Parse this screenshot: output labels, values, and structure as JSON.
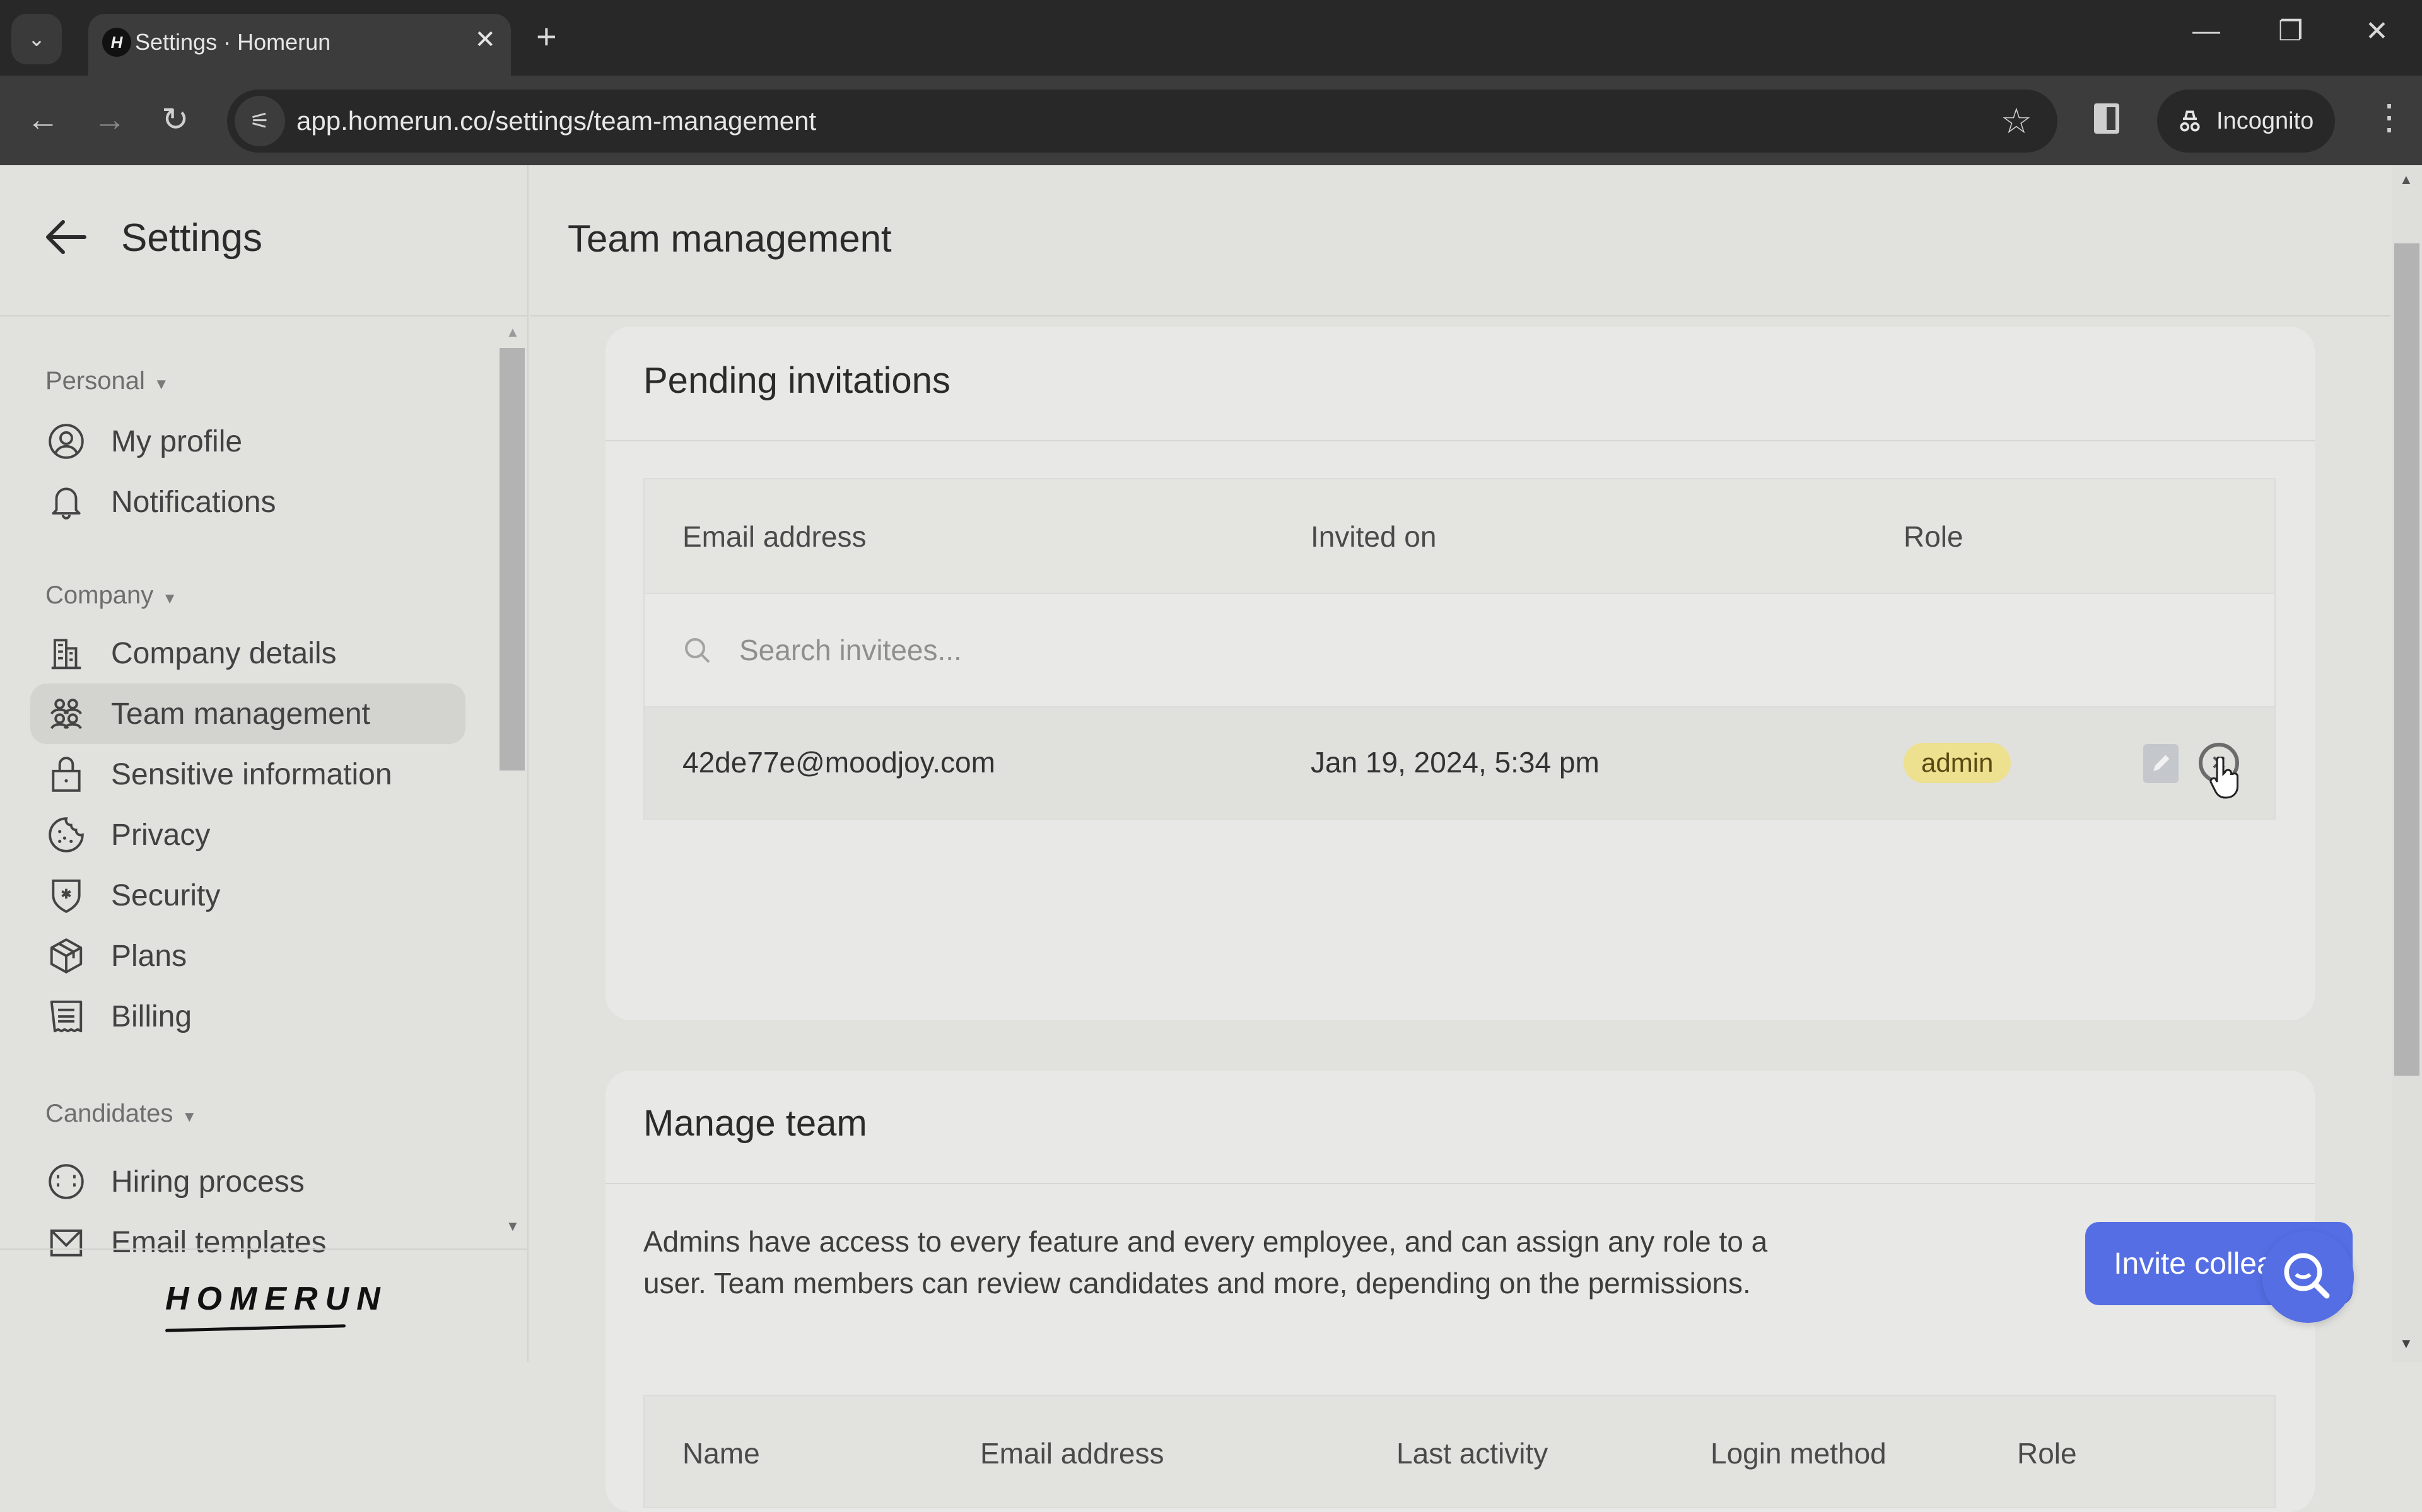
{
  "browser": {
    "tab_title": "Settings · Homerun",
    "favicon_letter": "H",
    "url": "app.homerun.co/settings/team-management",
    "incognito_label": "Incognito"
  },
  "sidebar": {
    "title": "Settings",
    "sections": [
      {
        "label": "Personal",
        "items": [
          {
            "label": "My profile",
            "icon": "user-circle-icon"
          },
          {
            "label": "Notifications",
            "icon": "bell-icon"
          }
        ]
      },
      {
        "label": "Company",
        "items": [
          {
            "label": "Company details",
            "icon": "building-icon"
          },
          {
            "label": "Team management",
            "icon": "team-icon",
            "active": true
          },
          {
            "label": "Sensitive information",
            "icon": "lock-icon"
          },
          {
            "label": "Privacy",
            "icon": "cookie-icon"
          },
          {
            "label": "Security",
            "icon": "shield-icon"
          },
          {
            "label": "Plans",
            "icon": "box-icon"
          },
          {
            "label": "Billing",
            "icon": "receipt-icon"
          }
        ]
      },
      {
        "label": "Candidates",
        "items": [
          {
            "label": "Hiring process",
            "icon": "baseball-icon"
          },
          {
            "label": "Email templates",
            "icon": "mail-icon"
          }
        ]
      }
    ],
    "logo": "HOMERUN"
  },
  "main": {
    "title": "Team management",
    "pending": {
      "title": "Pending invitations",
      "columns": [
        "Email address",
        "Invited on",
        "Role"
      ],
      "search_placeholder": "Search invitees...",
      "search_value": "",
      "rows": [
        {
          "email": "42de77e@moodjoy.com",
          "invited_on": "Jan 19, 2024, 5:34 pm",
          "role": "admin"
        }
      ]
    },
    "manage": {
      "title": "Manage team",
      "description": "Admins have access to every feature and every employee, and can assign any role to a user. Team members can review candidates and more, depending on the permissions.",
      "invite_button": "Invite colleague",
      "columns": [
        "Name",
        "Email address",
        "Last activity",
        "Login method",
        "Role"
      ]
    }
  },
  "colors": {
    "accent": "#556ee4",
    "admin_badge": "#ede08f",
    "background": "#e1e1de"
  }
}
